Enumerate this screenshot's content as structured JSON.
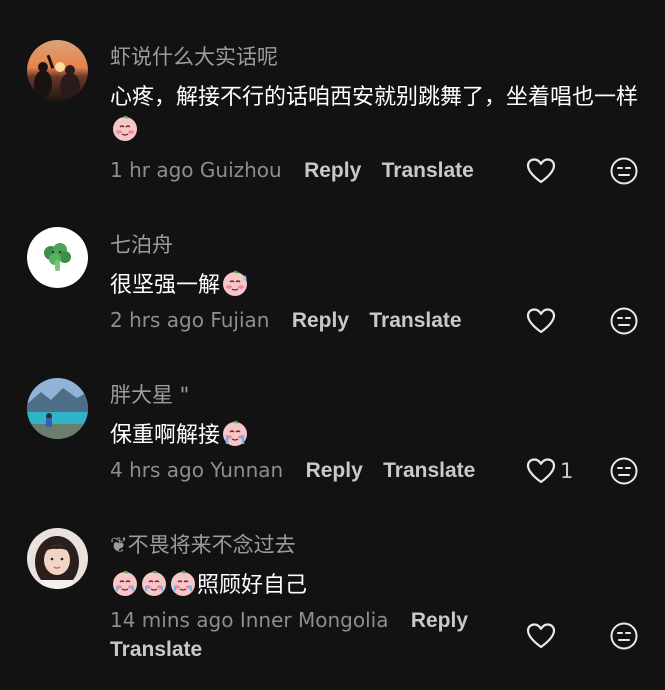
{
  "comments": [
    {
      "username": "虾说什么大实话呢",
      "text": "心疼，解接不行的话咱西安就别跳舞了，坐着唱也一样",
      "emoji": [
        "blush-face-emoji"
      ],
      "time": "1 hr ago",
      "location": "Guizhou",
      "reply_label": "Reply",
      "translate_label": "Translate",
      "like_count": ""
    },
    {
      "username": "七泊舟",
      "text": "很坚强一解",
      "emoji": [
        "sweat-face-emoji"
      ],
      "time": "2 hrs ago",
      "location": "Fujian",
      "reply_label": "Reply",
      "translate_label": "Translate",
      "like_count": ""
    },
    {
      "username": "胖大星 \"",
      "text": "保重啊解接",
      "emoji": [
        "crying-face-emoji"
      ],
      "time": "4 hrs ago",
      "location": "Yunnan",
      "reply_label": "Reply",
      "translate_label": "Translate",
      "like_count": "1"
    },
    {
      "username": "❦不畏将来不念过去",
      "text": "照顾好自己",
      "emoji": [
        "teary-face-emoji",
        "teary-face-emoji",
        "teary-face-emoji"
      ],
      "time": "14 mins ago",
      "location": "Inner Mongolia",
      "reply_label": "Reply",
      "translate_label": "Translate",
      "like_count": ""
    }
  ],
  "icons": {
    "like": "heart-outline-icon",
    "dislike": "neutral-face-icon"
  },
  "colors": {
    "background": "#121212",
    "username": "#9c9ca0",
    "body_text": "#ffffff",
    "meta": "#8d8d92",
    "action": "#c9c9cc"
  }
}
